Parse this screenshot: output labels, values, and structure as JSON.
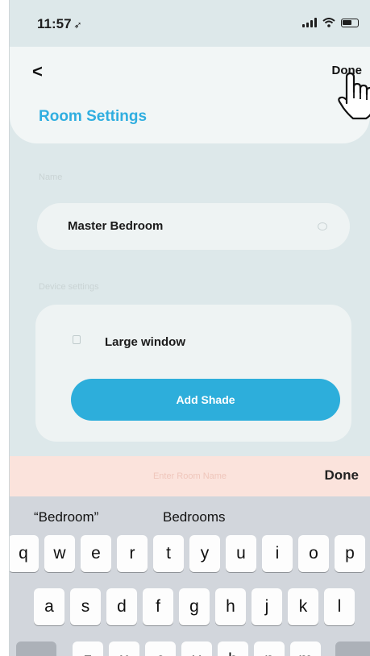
{
  "status_bar": {
    "time": "11:57",
    "location_glyph": "➶"
  },
  "header": {
    "back_label": "<",
    "done_label": "Done",
    "title": "Room Settings"
  },
  "name_section": {
    "label": "Name",
    "value": "Master Bedroom"
  },
  "device_section": {
    "label": "Device settings",
    "device_name": "Large window",
    "add_button": "Add Shade"
  },
  "keyboard_accessory": {
    "hint": "Enter Room Name",
    "done_label": "Done"
  },
  "keyboard": {
    "suggestions": [
      "“Bedroom”",
      "Bedrooms"
    ],
    "row1": [
      "q",
      "w",
      "e",
      "r",
      "t",
      "y",
      "u",
      "i",
      "o",
      "p"
    ],
    "row2": [
      "a",
      "s",
      "d",
      "f",
      "g",
      "h",
      "j",
      "k",
      "l"
    ],
    "row3": [
      "z",
      "x",
      "c",
      "v",
      "b",
      "n",
      "m"
    ]
  },
  "colors": {
    "accent": "#30aee0",
    "button": "#2daedb",
    "accessory_bar": "#fbe3dc"
  }
}
